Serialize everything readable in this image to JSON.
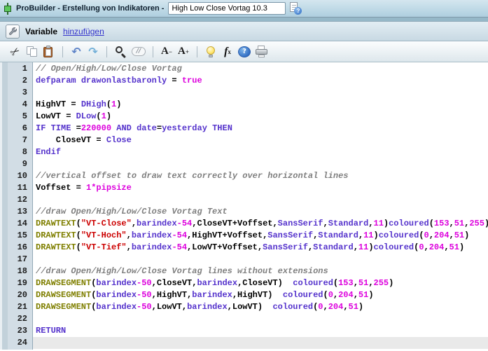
{
  "window": {
    "title_left": "ProBuilder -  Erstellung von Indikatoren  -",
    "title_input_value": "High Low Close Vortag 10.3"
  },
  "variable_bar": {
    "label": "Variable",
    "link": "hinzufügen"
  },
  "toolbar": {
    "items": [
      {
        "name": "cut-icon",
        "kind": "cut",
        "glyph": "✂",
        "color": "#3a3a3a"
      },
      {
        "name": "copy-icon",
        "kind": "copy"
      },
      {
        "name": "paste-icon",
        "kind": "paste"
      },
      {
        "name": "toolbar-separator",
        "kind": "sep"
      },
      {
        "name": "undo-icon",
        "kind": "glyph",
        "glyph": "↶",
        "color": "#5f84c8"
      },
      {
        "name": "redo-icon",
        "kind": "glyph",
        "glyph": "↷",
        "color": "#74b0d8"
      },
      {
        "name": "toolbar-separator",
        "kind": "sep"
      },
      {
        "name": "search-icon",
        "kind": "search"
      },
      {
        "name": "comment-icon",
        "kind": "comment",
        "label": "//"
      },
      {
        "name": "toolbar-separator",
        "kind": "sep"
      },
      {
        "name": "font-decrease-icon",
        "kind": "fontsize",
        "base": "A",
        "sign": "−"
      },
      {
        "name": "font-increase-icon",
        "kind": "fontsize",
        "base": "A",
        "sign": "+"
      },
      {
        "name": "toolbar-separator",
        "kind": "sep"
      },
      {
        "name": "hint-bulb-icon",
        "kind": "bulb"
      },
      {
        "name": "insert-function-icon",
        "kind": "fx",
        "base": "f",
        "sub": "x"
      },
      {
        "name": "help-icon",
        "kind": "help",
        "label": "?"
      },
      {
        "name": "print-icon",
        "kind": "print"
      }
    ]
  },
  "editor": {
    "colors": {
      "kw": "#5533cc",
      "num": "#dd00dd",
      "str": "#cc0000",
      "com": "#7f7f7f",
      "fn": "#7f7f00",
      "pl": "#000000"
    },
    "lines": [
      {
        "n": 1,
        "tokens": [
          [
            "com",
            "// Open/High/Low/Close Vortag"
          ]
        ]
      },
      {
        "n": 2,
        "tokens": [
          [
            "kw",
            "defparam"
          ],
          [
            "pl",
            " "
          ],
          [
            "kw",
            "drawonlastbaronly"
          ],
          [
            "pl",
            " = "
          ],
          [
            "num",
            "true"
          ]
        ]
      },
      {
        "n": 3,
        "tokens": []
      },
      {
        "n": 4,
        "tokens": [
          [
            "pl",
            "HighVT = "
          ],
          [
            "kw",
            "DHigh"
          ],
          [
            "pl",
            "("
          ],
          [
            "num",
            "1"
          ],
          [
            "pl",
            ")"
          ]
        ]
      },
      {
        "n": 5,
        "tokens": [
          [
            "pl",
            "LowVT = "
          ],
          [
            "kw",
            "DLow"
          ],
          [
            "pl",
            "("
          ],
          [
            "num",
            "1"
          ],
          [
            "pl",
            ")"
          ]
        ]
      },
      {
        "n": 6,
        "tokens": [
          [
            "kw",
            "IF"
          ],
          [
            "pl",
            " "
          ],
          [
            "kw",
            "TIME"
          ],
          [
            "pl",
            " ="
          ],
          [
            "num",
            "220000"
          ],
          [
            "pl",
            " "
          ],
          [
            "kw",
            "AND"
          ],
          [
            "pl",
            " "
          ],
          [
            "kw",
            "date"
          ],
          [
            "pl",
            "="
          ],
          [
            "kw",
            "yesterday"
          ],
          [
            "pl",
            " "
          ],
          [
            "kw",
            "THEN"
          ]
        ]
      },
      {
        "n": 7,
        "tokens": [
          [
            "pl",
            "    CloseVT = "
          ],
          [
            "kw",
            "Close"
          ]
        ]
      },
      {
        "n": 8,
        "tokens": [
          [
            "kw",
            "Endif"
          ]
        ]
      },
      {
        "n": 9,
        "tokens": []
      },
      {
        "n": 10,
        "tokens": [
          [
            "com",
            "//vertical offset to draw text correctly over horizontal lines"
          ]
        ]
      },
      {
        "n": 11,
        "tokens": [
          [
            "pl",
            "Voffset = "
          ],
          [
            "num",
            "1*pipsize"
          ]
        ]
      },
      {
        "n": 12,
        "tokens": []
      },
      {
        "n": 13,
        "tokens": [
          [
            "com",
            "//draw Open/High/Low/Close Vortag Text"
          ]
        ]
      },
      {
        "n": 14,
        "tokens": [
          [
            "fn",
            "DRAWTEXT"
          ],
          [
            "pl",
            "("
          ],
          [
            "str",
            "\"VT-Close\""
          ],
          [
            "pl",
            ","
          ],
          [
            "kw",
            "barindex"
          ],
          [
            "num",
            "-54"
          ],
          [
            "pl",
            ",CloseVT+Voffset,"
          ],
          [
            "kw",
            "SansSerif"
          ],
          [
            "pl",
            ","
          ],
          [
            "kw",
            "Standard"
          ],
          [
            "pl",
            ","
          ],
          [
            "num",
            "11"
          ],
          [
            "pl",
            ")"
          ],
          [
            "kw",
            "coloured"
          ],
          [
            "pl",
            "("
          ],
          [
            "num",
            "153"
          ],
          [
            "pl",
            ","
          ],
          [
            "num",
            "51"
          ],
          [
            "pl",
            ","
          ],
          [
            "num",
            "255"
          ],
          [
            "pl",
            ")"
          ]
        ]
      },
      {
        "n": 15,
        "tokens": [
          [
            "fn",
            "DRAWTEXT"
          ],
          [
            "pl",
            "("
          ],
          [
            "str",
            "\"VT-Hoch\""
          ],
          [
            "pl",
            ","
          ],
          [
            "kw",
            "barindex"
          ],
          [
            "num",
            "-54"
          ],
          [
            "pl",
            ",HighVT+Voffset,"
          ],
          [
            "kw",
            "SansSerif"
          ],
          [
            "pl",
            ","
          ],
          [
            "kw",
            "Standard"
          ],
          [
            "pl",
            ","
          ],
          [
            "num",
            "11"
          ],
          [
            "pl",
            ")"
          ],
          [
            "kw",
            "coloured"
          ],
          [
            "pl",
            "("
          ],
          [
            "num",
            "0"
          ],
          [
            "pl",
            ","
          ],
          [
            "num",
            "204"
          ],
          [
            "pl",
            ","
          ],
          [
            "num",
            "51"
          ],
          [
            "pl",
            ")"
          ]
        ]
      },
      {
        "n": 16,
        "tokens": [
          [
            "fn",
            "DRAWTEXT"
          ],
          [
            "pl",
            "("
          ],
          [
            "str",
            "\"VT-Tief\""
          ],
          [
            "pl",
            ","
          ],
          [
            "kw",
            "barindex"
          ],
          [
            "num",
            "-54"
          ],
          [
            "pl",
            ",LowVT+Voffset,"
          ],
          [
            "kw",
            "SansSerif"
          ],
          [
            "pl",
            ","
          ],
          [
            "kw",
            "Standard"
          ],
          [
            "pl",
            ","
          ],
          [
            "num",
            "11"
          ],
          [
            "pl",
            ")"
          ],
          [
            "kw",
            "coloured"
          ],
          [
            "pl",
            "("
          ],
          [
            "num",
            "0"
          ],
          [
            "pl",
            ","
          ],
          [
            "num",
            "204"
          ],
          [
            "pl",
            ","
          ],
          [
            "num",
            "51"
          ],
          [
            "pl",
            ")"
          ]
        ]
      },
      {
        "n": 17,
        "tokens": []
      },
      {
        "n": 18,
        "tokens": [
          [
            "com",
            "//draw Open/High/Low/Close Vortag lines without extensions"
          ]
        ]
      },
      {
        "n": 19,
        "tokens": [
          [
            "fn",
            "DRAWSEGMENT"
          ],
          [
            "pl",
            "("
          ],
          [
            "kw",
            "barindex"
          ],
          [
            "num",
            "-50"
          ],
          [
            "pl",
            ",CloseVT,"
          ],
          [
            "kw",
            "barindex"
          ],
          [
            "pl",
            ",CloseVT)  "
          ],
          [
            "kw",
            "coloured"
          ],
          [
            "pl",
            "("
          ],
          [
            "num",
            "153"
          ],
          [
            "pl",
            ","
          ],
          [
            "num",
            "51"
          ],
          [
            "pl",
            ","
          ],
          [
            "num",
            "255"
          ],
          [
            "pl",
            ")"
          ]
        ]
      },
      {
        "n": 20,
        "tokens": [
          [
            "fn",
            "DRAWSEGMENT"
          ],
          [
            "pl",
            "("
          ],
          [
            "kw",
            "barindex"
          ],
          [
            "num",
            "-50"
          ],
          [
            "pl",
            ",HighVT,"
          ],
          [
            "kw",
            "barindex"
          ],
          [
            "pl",
            ",HighVT)  "
          ],
          [
            "kw",
            "coloured"
          ],
          [
            "pl",
            "("
          ],
          [
            "num",
            "0"
          ],
          [
            "pl",
            ","
          ],
          [
            "num",
            "204"
          ],
          [
            "pl",
            ","
          ],
          [
            "num",
            "51"
          ],
          [
            "pl",
            ")"
          ]
        ]
      },
      {
        "n": 21,
        "tokens": [
          [
            "fn",
            "DRAWSEGMENT"
          ],
          [
            "pl",
            "("
          ],
          [
            "kw",
            "barindex"
          ],
          [
            "num",
            "-50"
          ],
          [
            "pl",
            ",LowVT,"
          ],
          [
            "kw",
            "barindex"
          ],
          [
            "pl",
            ",LowVT)  "
          ],
          [
            "kw",
            "coloured"
          ],
          [
            "pl",
            "("
          ],
          [
            "num",
            "0"
          ],
          [
            "pl",
            ","
          ],
          [
            "num",
            "204"
          ],
          [
            "pl",
            ","
          ],
          [
            "num",
            "51"
          ],
          [
            "pl",
            ")"
          ]
        ]
      },
      {
        "n": 22,
        "tokens": []
      },
      {
        "n": 23,
        "tokens": [
          [
            "kw",
            "RETURN"
          ]
        ]
      },
      {
        "n": 24,
        "tokens": [],
        "highlight": true
      }
    ]
  }
}
